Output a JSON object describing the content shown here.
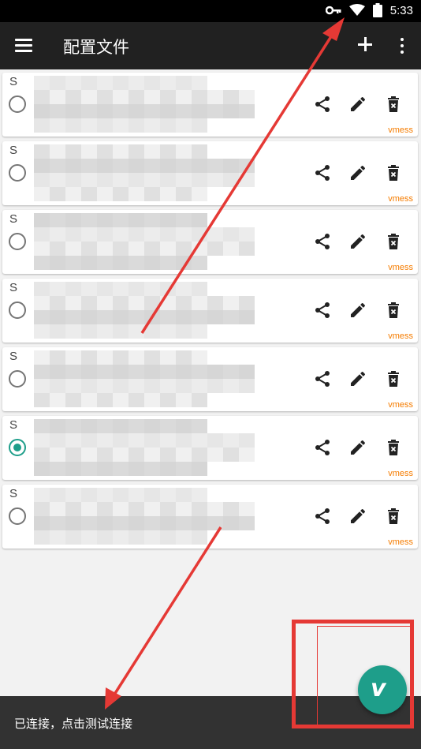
{
  "status_bar": {
    "time": "5:33",
    "icons": [
      "vpn-key-icon",
      "wifi-icon",
      "battery-icon"
    ]
  },
  "app_bar": {
    "title": "配置文件",
    "menu_icon": "hamburger-menu-icon",
    "add_icon": "plus-icon",
    "more_icon": "more-vert-icon"
  },
  "profiles": [
    {
      "label": "S",
      "selected": false,
      "type": "vmess"
    },
    {
      "label": "S",
      "selected": false,
      "type": "vmess"
    },
    {
      "label": "S",
      "selected": false,
      "type": "vmess"
    },
    {
      "label": "S",
      "selected": false,
      "type": "vmess"
    },
    {
      "label": "S",
      "selected": false,
      "type": "vmess"
    },
    {
      "label": "S",
      "selected": true,
      "type": "vmess"
    },
    {
      "label": "S",
      "selected": false,
      "type": "vmess"
    }
  ],
  "snackbar": {
    "message": "已连接，点击测试连接"
  },
  "fab": {
    "label": "v",
    "icon": "v2ray-logo-icon"
  },
  "colors": {
    "accent": "#1e9e8a",
    "type_label": "#f57c00",
    "annotation": "#e53935",
    "app_bar": "#212121",
    "snackbar": "#323232"
  }
}
